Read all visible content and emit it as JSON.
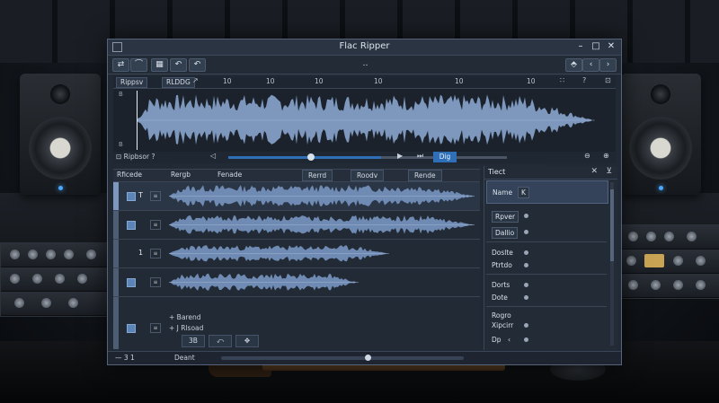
{
  "app": {
    "title": "Flac Ripper"
  },
  "window_controls": {
    "minimize": "–",
    "maximize": "□",
    "close": "✕"
  },
  "toolbar": {
    "left_buttons": [
      "⇄",
      "⌒",
      "▦",
      "↶",
      "↶"
    ],
    "center": "‥",
    "right_buttons": [
      "⬘",
      "‹",
      "›"
    ]
  },
  "ruler": {
    "tab1": "Rippsv",
    "tab2": "RLDDG",
    "tab3": "↗",
    "ticks": [
      "10",
      "10",
      "10",
      "10",
      "10",
      "10"
    ],
    "right_icons": [
      "∷",
      "?",
      "⊡"
    ]
  },
  "overview": {
    "level_top": "B",
    "level_bottom": "B"
  },
  "transport": {
    "label": "⊡ Ripbsor  ?",
    "vol_icon": "◁",
    "play": "▶",
    "next": "⏭",
    "button": "Dig",
    "right_icons": [
      "⊖",
      "⊕"
    ]
  },
  "tracks_header": {
    "col1": "Rficede",
    "col2": "Rergb",
    "col3": "Fenade",
    "col4": "Rerrd",
    "col5": "Roodv",
    "col6": "Rende",
    "col7": "Tiect"
  },
  "tracks": [
    {
      "num": "T",
      "small": "≡"
    },
    {
      "num": "",
      "small": "≡"
    },
    {
      "num": "1",
      "small": "≡"
    },
    {
      "num": "",
      "small": "≡"
    },
    {
      "num": "",
      "small": "≡"
    }
  ],
  "bottom": {
    "line1": "+ Barend",
    "line2": "+ J Rlsoad",
    "btn1": "3B",
    "btn2": "⤺",
    "btn3": "✥"
  },
  "status": {
    "left": "— 3 1",
    "center": "Deant"
  },
  "side_panel": {
    "title": "Tiect",
    "rows": [
      {
        "label": "Name",
        "btn": "K"
      },
      {
        "label": "Rpver"
      },
      {
        "label": "Dallio"
      },
      {
        "label": "Doslte"
      },
      {
        "label": "Ptrtdo"
      },
      {
        "label": "Dorts"
      },
      {
        "label": "Dote"
      },
      {
        "label": "Rogro"
      },
      {
        "label": "Xipcirr"
      },
      {
        "label": "Dp",
        "btn": "‹"
      }
    ]
  },
  "colors": {
    "accent": "#2f6fb8",
    "waveform": "#7d97bd",
    "window": "#222a35"
  }
}
